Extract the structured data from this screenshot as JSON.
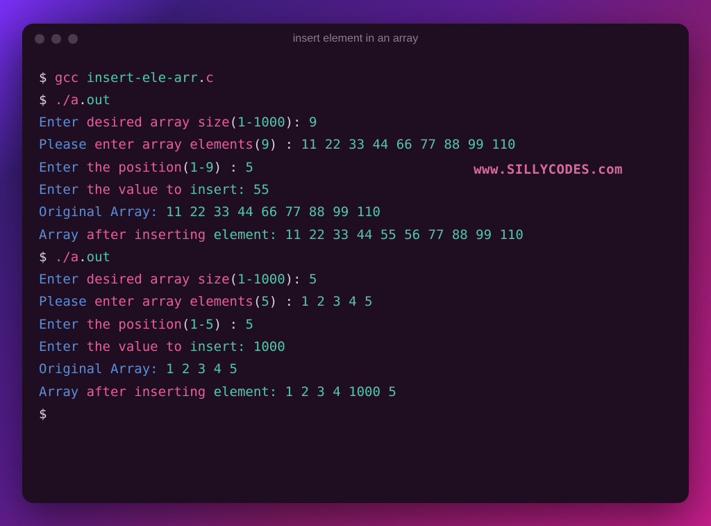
{
  "window": {
    "title": "insert element in an array"
  },
  "watermark": "www.SILLYCODES.com",
  "terminal": {
    "lines": [
      {
        "segments": [
          {
            "cls": "c-dollar",
            "t": "$ "
          },
          {
            "cls": "c-gcc",
            "t": "gcc "
          },
          {
            "cls": "c-file",
            "t": "insert-ele-arr"
          },
          {
            "cls": "c-dot",
            "t": "."
          },
          {
            "cls": "c-ext",
            "t": "c"
          }
        ]
      },
      {
        "segments": [
          {
            "cls": "c-dollar",
            "t": "$ "
          },
          {
            "cls": "c-exe",
            "t": "./a"
          },
          {
            "cls": "c-dot",
            "t": "."
          },
          {
            "cls": "c-out",
            "t": "out"
          }
        ]
      },
      {
        "segments": [
          {
            "cls": "c-enter",
            "t": "Enter "
          },
          {
            "cls": "c-word",
            "t": "desired array size"
          },
          {
            "cls": "c-paren",
            "t": "("
          },
          {
            "cls": "c-num",
            "t": "1-1000"
          },
          {
            "cls": "c-paren",
            "t": "): "
          },
          {
            "cls": "c-num",
            "t": "9"
          }
        ]
      },
      {
        "segments": [
          {
            "cls": "c-label",
            "t": "Please "
          },
          {
            "cls": "c-word",
            "t": "enter array elements"
          },
          {
            "cls": "c-paren",
            "t": "("
          },
          {
            "cls": "c-num",
            "t": "9"
          },
          {
            "cls": "c-paren",
            "t": ") : "
          },
          {
            "cls": "c-num",
            "t": "11 22 33 44 66 77 88 99 110"
          }
        ]
      },
      {
        "segments": [
          {
            "cls": "c-enter",
            "t": "Enter "
          },
          {
            "cls": "c-word",
            "t": "the position"
          },
          {
            "cls": "c-paren",
            "t": "("
          },
          {
            "cls": "c-num",
            "t": "1-9"
          },
          {
            "cls": "c-paren",
            "t": ") : "
          },
          {
            "cls": "c-num",
            "t": "5"
          }
        ]
      },
      {
        "segments": [
          {
            "cls": "c-enter",
            "t": "Enter "
          },
          {
            "cls": "c-word",
            "t": "the value to "
          },
          {
            "cls": "c-element",
            "t": "insert: "
          },
          {
            "cls": "c-num",
            "t": "55"
          }
        ]
      },
      {
        "segments": [
          {
            "cls": "c-label",
            "t": "Original Array: "
          },
          {
            "cls": "c-num",
            "t": "11 22 33 44 66 77 88 99 110"
          }
        ]
      },
      {
        "segments": [
          {
            "cls": "c-label",
            "t": "Array "
          },
          {
            "cls": "c-after",
            "t": "after inserting "
          },
          {
            "cls": "c-element",
            "t": "element: "
          },
          {
            "cls": "c-num",
            "t": "11 22 33 44 55 56 77 88 99 110"
          }
        ]
      },
      {
        "segments": [
          {
            "cls": "c-dollar",
            "t": "$ "
          },
          {
            "cls": "c-exe",
            "t": "./a"
          },
          {
            "cls": "c-dot",
            "t": "."
          },
          {
            "cls": "c-out",
            "t": "out"
          }
        ]
      },
      {
        "segments": [
          {
            "cls": "c-enter",
            "t": "Enter "
          },
          {
            "cls": "c-word",
            "t": "desired array size"
          },
          {
            "cls": "c-paren",
            "t": "("
          },
          {
            "cls": "c-num",
            "t": "1-1000"
          },
          {
            "cls": "c-paren",
            "t": "): "
          },
          {
            "cls": "c-num",
            "t": "5"
          }
        ]
      },
      {
        "segments": [
          {
            "cls": "c-label",
            "t": "Please "
          },
          {
            "cls": "c-word",
            "t": "enter array elements"
          },
          {
            "cls": "c-paren",
            "t": "("
          },
          {
            "cls": "c-num",
            "t": "5"
          },
          {
            "cls": "c-paren",
            "t": ") : "
          },
          {
            "cls": "c-num",
            "t": "1 2 3 4 5"
          }
        ]
      },
      {
        "segments": [
          {
            "cls": "c-enter",
            "t": "Enter "
          },
          {
            "cls": "c-word",
            "t": "the position"
          },
          {
            "cls": "c-paren",
            "t": "("
          },
          {
            "cls": "c-num",
            "t": "1-5"
          },
          {
            "cls": "c-paren",
            "t": ") : "
          },
          {
            "cls": "c-num",
            "t": "5"
          }
        ]
      },
      {
        "segments": [
          {
            "cls": "c-enter",
            "t": "Enter "
          },
          {
            "cls": "c-word",
            "t": "the value to "
          },
          {
            "cls": "c-element",
            "t": "insert: "
          },
          {
            "cls": "c-num",
            "t": "1000"
          }
        ]
      },
      {
        "segments": [
          {
            "cls": "c-label",
            "t": "Original Array: "
          },
          {
            "cls": "c-num",
            "t": "1 2 3 4 5"
          }
        ]
      },
      {
        "segments": [
          {
            "cls": "c-label",
            "t": "Array "
          },
          {
            "cls": "c-after",
            "t": "after inserting "
          },
          {
            "cls": "c-element",
            "t": "element: "
          },
          {
            "cls": "c-num",
            "t": "1 2 3 4 1000 5"
          }
        ]
      },
      {
        "segments": [
          {
            "cls": "c-dollar",
            "t": "$"
          }
        ]
      }
    ]
  }
}
